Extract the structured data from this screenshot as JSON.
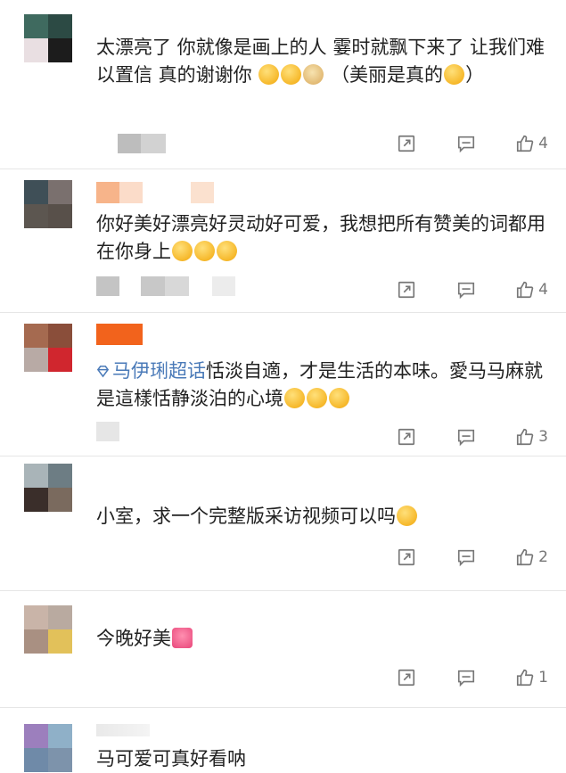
{
  "comments": [
    {
      "text_parts": [
        "太漂亮了 你就像是画上的人 霎时就飘下来了 让我们难以置信 真的谢谢你",
        "（美丽是真的",
        "）"
      ],
      "likes": "4"
    },
    {
      "text_parts": [
        "你好美好漂亮好灵动好可爱，我想把所有赞美的词都用在你身上"
      ],
      "likes": "4"
    },
    {
      "topic": "马伊琍超话",
      "text_parts": [
        "恬淡自適，才是生活的本味。愛马马麻就是這樣恬静淡泊的心境"
      ],
      "likes": "3"
    },
    {
      "text_parts": [
        "小室，求一个完整版采访视频可以吗"
      ],
      "likes": "2"
    },
    {
      "text_parts": [
        "今晚好美"
      ],
      "likes": "1"
    },
    {
      "text_parts": [
        "马可爱可真好看呐"
      ],
      "likes": ""
    }
  ],
  "icons": {
    "share": "share-icon",
    "comment": "comment-icon",
    "like": "thumbs-up-icon"
  },
  "colors": {
    "topic": "#4a7ab8",
    "divider": "#e6e6e6",
    "action_gray": "#777777"
  }
}
